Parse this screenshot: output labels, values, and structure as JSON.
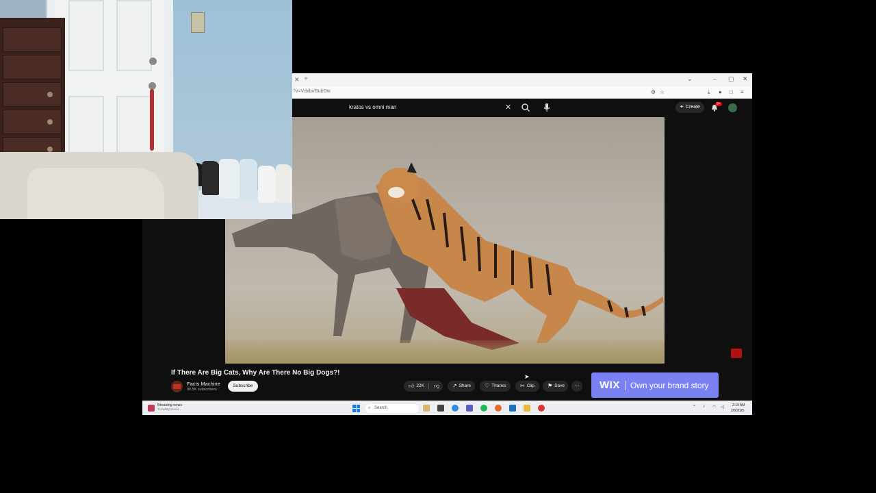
{
  "browser": {
    "url": "?v=Vdxbnl5ubDw",
    "window_controls": [
      "⌄",
      "–",
      "▢",
      "✕"
    ]
  },
  "youtube": {
    "search": {
      "value": "kratos vs omni man",
      "clear_icon": "close-icon",
      "search_icon": "search-icon",
      "mic_icon": "mic-icon"
    },
    "create_label": "Create",
    "notifications_badge": "9+",
    "video": {
      "title": "If There Are Big Cats, Why Are There No Big Dogs?!",
      "channel_name": "Facts Machine",
      "subscribers": "98.5K subscribers",
      "subscribe_label": "Subscribe",
      "like_count": "22K",
      "share_label": "Share",
      "thanks_label": "Thanks",
      "clip_label": "Clip",
      "save_label": "Save",
      "more_label": "···"
    },
    "ad": {
      "brand": "WIX",
      "text": "Own your brand story",
      "bg_color": "#7a82f3"
    }
  },
  "taskbar": {
    "news_title": "Breaking news",
    "news_sub": "Trending stories",
    "search_placeholder": "Search",
    "clock_time": "2:19 AM",
    "clock_date": "2/8/2025"
  },
  "colors": {
    "youtube_bg": "#0f0f0f",
    "pill_bg": "#272727",
    "accent_red": "#e00000"
  }
}
